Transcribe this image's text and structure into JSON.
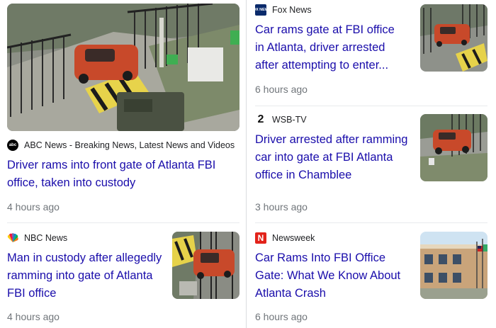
{
  "articles": [
    {
      "source": "ABC News - Breaking News, Latest News and Videos",
      "logo_text": "abc",
      "headline": "Driver rams into front gate of Atlanta FBI office, taken into custody",
      "time": "4 hours ago"
    },
    {
      "source": "Fox News",
      "logo_text": "FOX NEWS",
      "headline": "Car rams gate at FBI office in Atlanta, driver arrested after attempting to enter...",
      "time": "6 hours ago"
    },
    {
      "source": "WSB-TV",
      "logo_text": "2",
      "headline": "Driver arrested after ramming car into gate at FBI Atlanta office in Chamblee",
      "time": "3 hours ago"
    },
    {
      "source": "NBC News",
      "logo_text": "",
      "headline": "Man in custody after allegedly ramming into gate of Atlanta FBI office",
      "time": "4 hours ago"
    },
    {
      "source": "Newsweek",
      "logo_text": "N",
      "headline": "Car Rams Into FBI Office Gate: What We Know About Atlanta Crash",
      "time": "6 hours ago"
    }
  ],
  "colors": {
    "headline": "#1a0dab",
    "meta": "#70757a",
    "car": "#c8492a",
    "newsweek_red": "#e2231a"
  },
  "icons": [
    "abc-news-logo",
    "fox-news-logo",
    "wsb-tv-logo",
    "nbc-peacock-logo",
    "newsweek-logo"
  ]
}
